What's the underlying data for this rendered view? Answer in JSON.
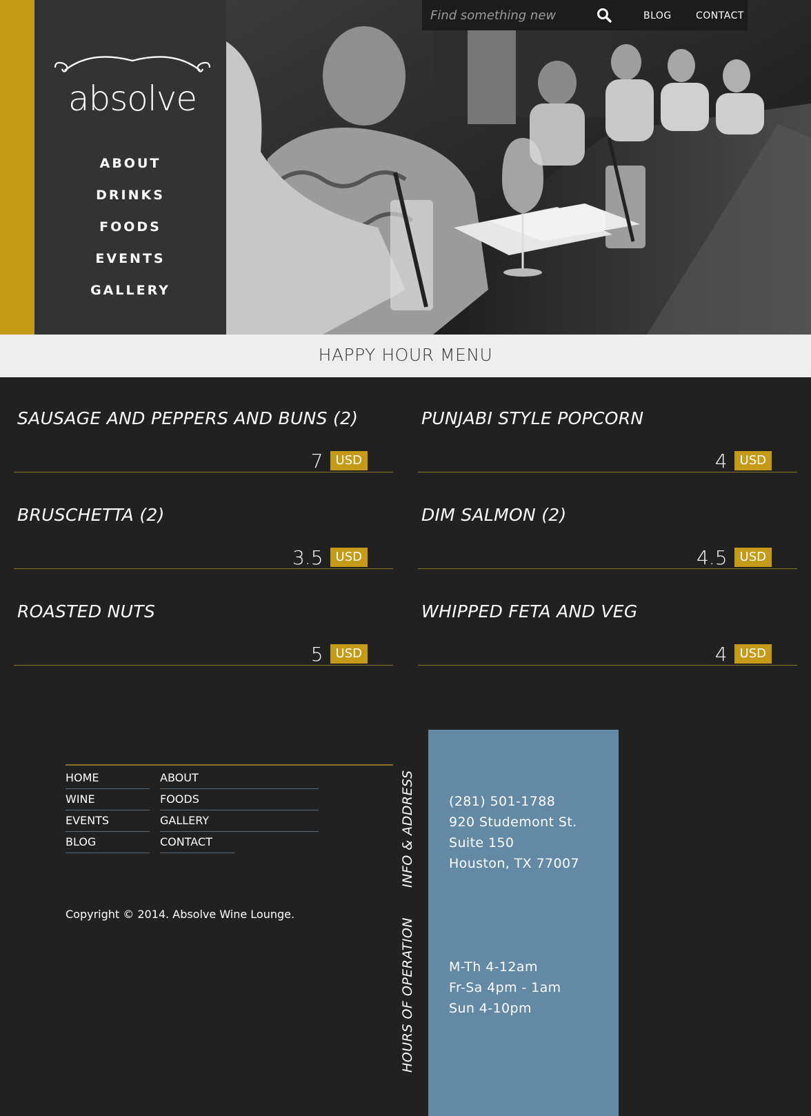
{
  "brand": {
    "logo_text": "absolve"
  },
  "main_nav": {
    "items": [
      {
        "label": "ABOUT"
      },
      {
        "label": "DRINKS"
      },
      {
        "label": "FOODS"
      },
      {
        "label": "EVENTS"
      },
      {
        "label": "GALLERY"
      }
    ]
  },
  "topbar": {
    "search_placeholder": "Find something new",
    "search_icon": "search-icon",
    "links": [
      {
        "label": "BLOG"
      },
      {
        "label": "CONTACT"
      }
    ]
  },
  "section": {
    "title": "HAPPY HOUR MENU"
  },
  "menu": {
    "items": [
      {
        "name": "SAUSAGE AND PEPPERS AND BUNS (2)",
        "price": "7",
        "currency": "USD"
      },
      {
        "name": "PUNJABI STYLE POPCORN",
        "price": "4",
        "currency": "USD"
      },
      {
        "name": "BRUSCHETTA (2)",
        "price": "3.5",
        "currency": "USD"
      },
      {
        "name": "DIM SALMON (2)",
        "price": "4.5",
        "currency": "USD"
      },
      {
        "name": "ROASTED NUTS",
        "price": "5",
        "currency": "USD"
      },
      {
        "name": "WHIPPED FETA AND VEG",
        "price": "4",
        "currency": "USD"
      }
    ]
  },
  "footer": {
    "nav": [
      {
        "label": "HOME"
      },
      {
        "label": "ABOUT"
      },
      {
        "label": "WINE"
      },
      {
        "label": "FOODS"
      },
      {
        "label": "EVENTS"
      },
      {
        "label": "GALLERY"
      },
      {
        "label": "BLOG"
      },
      {
        "label": "CONTACT"
      }
    ],
    "copyright": "Copyright © 2014. Absolve Wine Lounge.",
    "info_label": "INFO & ADDRESS",
    "hours_label": "HOURS OF OPERATION",
    "info_lines": [
      "(281) 501-1788",
      "920 Studemont St.",
      "Suite 150",
      "Houston, TX 77007"
    ],
    "hours_lines": [
      "M-Th 4-12am",
      "Fr-Sa 4pm - 1am",
      "Sun 4-10pm"
    ]
  },
  "colors": {
    "accent": "#c49a16",
    "panel": "#6389a5",
    "background": "#212121",
    "sidebar": "#333333"
  }
}
